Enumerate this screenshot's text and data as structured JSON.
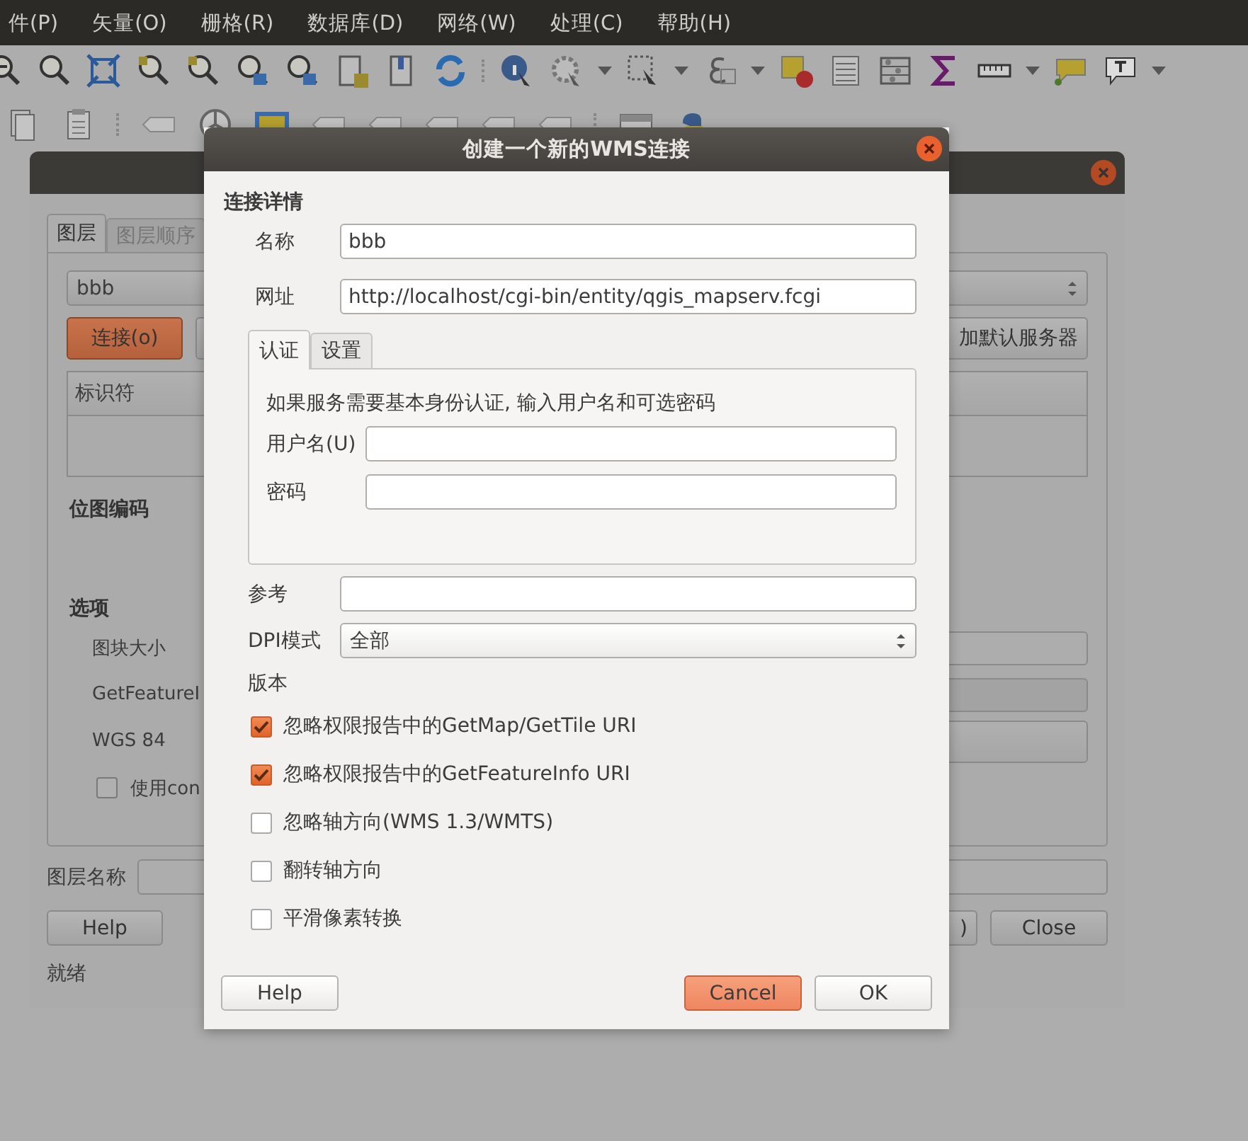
{
  "menu_bar": [
    {
      "label": "件(P)"
    },
    {
      "label": "矢量(O)"
    },
    {
      "label": "栅格(R)"
    },
    {
      "label": "数据库(D)"
    },
    {
      "label": "网络(W)"
    },
    {
      "label": "处理(C)"
    },
    {
      "label": "帮助(H)"
    }
  ],
  "background_dialog": {
    "tabs": [
      {
        "label": "图层",
        "selected": true
      },
      {
        "label": "图层顺序",
        "selected": false
      }
    ],
    "server_combo": "bbb",
    "connect_button": "连接(o)",
    "add_default_button": "加默认服务器",
    "table_columns": [
      "标识符"
    ],
    "image_encoding_heading": "位图编码",
    "options_heading": "选项",
    "options": [
      {
        "kind": "field",
        "label": "图块大小"
      },
      {
        "kind": "disabled-field",
        "label": "GetFeatureI"
      },
      {
        "kind": "button",
        "label": "WGS 84"
      },
      {
        "kind": "checkbox",
        "label": "使用con",
        "checked": false
      }
    ],
    "layer_name_label": "图层名称",
    "help_button": "Help",
    "partial_button": ")",
    "close_button": "Close",
    "status": "就绪"
  },
  "dialog": {
    "title": "创建一个新的WMS连接",
    "section": "连接详情",
    "name_label": "名称",
    "name_value": "bbb",
    "url_label": "网址",
    "url_value": "http://localhost/cgi-bin/entity/qgis_mapserv.fcgi",
    "tabs": [
      {
        "label": "认证",
        "selected": true
      },
      {
        "label": "设置",
        "selected": false
      }
    ],
    "auth_hint": "如果服务需要基本身份认证, 输入用户名和可选密码",
    "username_label": "用户名(U)",
    "password_label": "密码",
    "referer_label": "参考",
    "dpi_label": "DPI模式",
    "dpi_value": "全部",
    "version_label": "版本",
    "checkboxes": [
      {
        "label": "忽略权限报告中的GetMap/GetTile URI",
        "checked": true
      },
      {
        "label": "忽略权限报告中的GetFeatureInfo URI",
        "checked": true
      },
      {
        "label": "忽略轴方向(WMS 1.3/WMTS)",
        "checked": false
      },
      {
        "label": "翻转轴方向",
        "checked": false
      },
      {
        "label": "平滑像素转换",
        "checked": false
      }
    ],
    "help_button": "Help",
    "cancel_button": "Cancel",
    "ok_button": "OK"
  }
}
